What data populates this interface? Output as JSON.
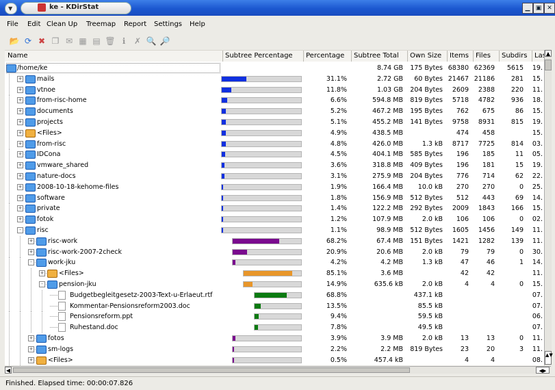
{
  "window": {
    "title": "ke - KDirStat"
  },
  "menu": [
    "File",
    "Edit",
    "Clean Up",
    "Treemap",
    "Report",
    "Settings",
    "Help"
  ],
  "toolbar_icons": [
    "open-folder-icon",
    "refresh-icon",
    "stop-icon",
    "copy-icon",
    "mail-icon",
    "compress-icon",
    "print-icon",
    "trash-icon",
    "info-icon",
    "delete-icon",
    "zoom-in-icon",
    "zoom-out-icon"
  ],
  "columns": {
    "name": "Name",
    "subtree_pct": "Subtree Percentage",
    "pct": "Percentage",
    "subtree_total": "Subtree Total",
    "own_size": "Own Size",
    "items": "Items",
    "files": "Files",
    "subdirs": "Subdirs",
    "last": "Last"
  },
  "colors": {
    "bar_bg": "#d8d8d8",
    "level1": "#1030e0",
    "level2": "#7a0a8e",
    "level3": "#e8962a",
    "level4": "#0a7a10",
    "folder": "#4f9be8",
    "files_folder": "#f0b040"
  },
  "rows": [
    {
      "name": "/home/ke",
      "level": 0,
      "type": "root",
      "expand": "",
      "pct": "",
      "subtree": "8.74 GB",
      "own": "175 Bytes",
      "items": "68380",
      "files": "62369",
      "subdirs": "5615",
      "last": "19.",
      "frac": null
    },
    {
      "name": "mails",
      "level": 1,
      "type": "folder",
      "expand": "+",
      "pct": "31.1%",
      "subtree": "2.72 GB",
      "own": "60 Bytes",
      "items": "21467",
      "files": "21186",
      "subdirs": "281",
      "last": "15.",
      "frac": 0.311
    },
    {
      "name": "vtnoe",
      "level": 1,
      "type": "folder",
      "expand": "+",
      "pct": "11.8%",
      "subtree": "1.03 GB",
      "own": "204 Bytes",
      "items": "2609",
      "files": "2388",
      "subdirs": "220",
      "last": "11.",
      "frac": 0.118
    },
    {
      "name": "from-risc-home",
      "level": 1,
      "type": "folder",
      "expand": "+",
      "pct": "6.6%",
      "subtree": "594.8 MB",
      "own": "819 Bytes",
      "items": "5718",
      "files": "4782",
      "subdirs": "936",
      "last": "18.",
      "frac": 0.066
    },
    {
      "name": "documents",
      "level": 1,
      "type": "folder",
      "expand": "+",
      "pct": "5.2%",
      "subtree": "467.2 MB",
      "own": "195 Bytes",
      "items": "762",
      "files": "675",
      "subdirs": "86",
      "last": "15.",
      "frac": 0.052
    },
    {
      "name": "projects",
      "level": 1,
      "type": "folder",
      "expand": "+",
      "pct": "5.1%",
      "subtree": "455.2 MB",
      "own": "141 Bytes",
      "items": "9758",
      "files": "8931",
      "subdirs": "815",
      "last": "19.",
      "frac": 0.051
    },
    {
      "name": "<Files>",
      "level": 1,
      "type": "files",
      "expand": "+",
      "pct": "4.9%",
      "subtree": "438.5 MB",
      "own": "",
      "items": "474",
      "files": "458",
      "subdirs": "",
      "last": "15.",
      "frac": 0.049
    },
    {
      "name": "from-risc",
      "level": 1,
      "type": "folder",
      "expand": "+",
      "pct": "4.8%",
      "subtree": "426.0 MB",
      "own": "1.3 kB",
      "items": "8717",
      "files": "7725",
      "subdirs": "814",
      "last": "03.",
      "frac": 0.048
    },
    {
      "name": "IDCona",
      "level": 1,
      "type": "folder",
      "expand": "+",
      "pct": "4.5%",
      "subtree": "404.1 MB",
      "own": "585 Bytes",
      "items": "196",
      "files": "185",
      "subdirs": "11",
      "last": "05.",
      "frac": 0.045
    },
    {
      "name": "vmware_shared",
      "level": 1,
      "type": "folder",
      "expand": "+",
      "pct": "3.6%",
      "subtree": "318.8 MB",
      "own": "409 Bytes",
      "items": "196",
      "files": "181",
      "subdirs": "15",
      "last": "19.",
      "frac": 0.036
    },
    {
      "name": "nature-docs",
      "level": 1,
      "type": "folder",
      "expand": "+",
      "pct": "3.1%",
      "subtree": "275.9 MB",
      "own": "204 Bytes",
      "items": "776",
      "files": "714",
      "subdirs": "62",
      "last": "22.",
      "frac": 0.031
    },
    {
      "name": "2008-10-18-kehome-files",
      "level": 1,
      "type": "folder",
      "expand": "+",
      "pct": "1.9%",
      "subtree": "166.4 MB",
      "own": "10.0 kB",
      "items": "270",
      "files": "270",
      "subdirs": "0",
      "last": "25.",
      "frac": 0.019
    },
    {
      "name": "software",
      "level": 1,
      "type": "folder",
      "expand": "+",
      "pct": "1.8%",
      "subtree": "156.9 MB",
      "own": "512 Bytes",
      "items": "512",
      "files": "443",
      "subdirs": "69",
      "last": "14.",
      "frac": 0.018
    },
    {
      "name": "private",
      "level": 1,
      "type": "folder",
      "expand": "+",
      "pct": "1.4%",
      "subtree": "122.2 MB",
      "own": "292 Bytes",
      "items": "2009",
      "files": "1843",
      "subdirs": "166",
      "last": "15.",
      "frac": 0.014
    },
    {
      "name": "fotok",
      "level": 1,
      "type": "folder",
      "expand": "+",
      "pct": "1.2%",
      "subtree": "107.9 MB",
      "own": "2.0 kB",
      "items": "106",
      "files": "106",
      "subdirs": "0",
      "last": "02.",
      "frac": 0.012
    },
    {
      "name": "risc",
      "level": 1,
      "type": "folder",
      "expand": "-",
      "pct": "1.1%",
      "subtree": "98.9 MB",
      "own": "512 Bytes",
      "items": "1605",
      "files": "1456",
      "subdirs": "149",
      "last": "11.",
      "frac": 0.011
    },
    {
      "name": "risc-work",
      "level": 2,
      "type": "folder",
      "expand": "+",
      "pct": "68.2%",
      "subtree": "67.4 MB",
      "own": "151 Bytes",
      "items": "1421",
      "files": "1282",
      "subdirs": "139",
      "last": "11.",
      "frac": 0.682
    },
    {
      "name": "risc-work-2007-2check",
      "level": 2,
      "type": "folder",
      "expand": "+",
      "pct": "20.9%",
      "subtree": "20.6 MB",
      "own": "2.0 kB",
      "items": "79",
      "files": "79",
      "subdirs": "0",
      "last": "30.",
      "frac": 0.209
    },
    {
      "name": "work-jku",
      "level": 2,
      "type": "folder",
      "expand": "-",
      "pct": "4.2%",
      "subtree": "4.2 MB",
      "own": "1.3 kB",
      "items": "47",
      "files": "46",
      "subdirs": "1",
      "last": "14.",
      "frac": 0.042
    },
    {
      "name": "<Files>",
      "level": 3,
      "type": "files",
      "expand": "+",
      "pct": "85.1%",
      "subtree": "3.6 MB",
      "own": "",
      "items": "42",
      "files": "42",
      "subdirs": "",
      "last": "11.",
      "frac": 0.851
    },
    {
      "name": "pension-jku",
      "level": 3,
      "type": "folder",
      "expand": "-",
      "pct": "14.9%",
      "subtree": "635.6 kB",
      "own": "2.0 kB",
      "items": "4",
      "files": "4",
      "subdirs": "0",
      "last": "15.",
      "frac": 0.149
    },
    {
      "name": "Budgetbegleitgesetz-2003-Text-u-Erlaeut.rtf",
      "level": 4,
      "type": "file",
      "expand": "",
      "pct": "68.8%",
      "subtree": "",
      "own": "437.1 kB",
      "items": "",
      "files": "",
      "subdirs": "",
      "last": "07.",
      "frac": 0.688
    },
    {
      "name": "Kommentar-Pensionsreform2003.doc",
      "level": 4,
      "type": "file",
      "expand": "",
      "pct": "13.5%",
      "subtree": "",
      "own": "85.5 kB",
      "items": "",
      "files": "",
      "subdirs": "",
      "last": "07.",
      "frac": 0.135
    },
    {
      "name": "Pensionsreform.ppt",
      "level": 4,
      "type": "file",
      "expand": "",
      "pct": "9.4%",
      "subtree": "",
      "own": "59.5 kB",
      "items": "",
      "files": "",
      "subdirs": "",
      "last": "06.",
      "frac": 0.094
    },
    {
      "name": "Ruhestand.doc",
      "level": 4,
      "type": "file",
      "expand": "",
      "pct": "7.8%",
      "subtree": "",
      "own": "49.5 kB",
      "items": "",
      "files": "",
      "subdirs": "",
      "last": "07.",
      "frac": 0.078
    },
    {
      "name": "fotos",
      "level": 2,
      "type": "folder",
      "expand": "+",
      "pct": "3.9%",
      "subtree": "3.9 MB",
      "own": "2.0 kB",
      "items": "13",
      "files": "13",
      "subdirs": "0",
      "last": "11.",
      "frac": 0.039
    },
    {
      "name": "sm-logs",
      "level": 2,
      "type": "folder",
      "expand": "+",
      "pct": "2.2%",
      "subtree": "2.2 MB",
      "own": "819 Bytes",
      "items": "23",
      "files": "20",
      "subdirs": "3",
      "last": "11.",
      "frac": 0.022
    },
    {
      "name": "<Files>",
      "level": 2,
      "type": "files",
      "expand": "+",
      "pct": "0.5%",
      "subtree": "457.4 kB",
      "own": "",
      "items": "4",
      "files": "4",
      "subdirs": "",
      "last": "08.",
      "frac": 0.005
    }
  ],
  "status": "Finished. Elapsed time: 00:00:07.826"
}
